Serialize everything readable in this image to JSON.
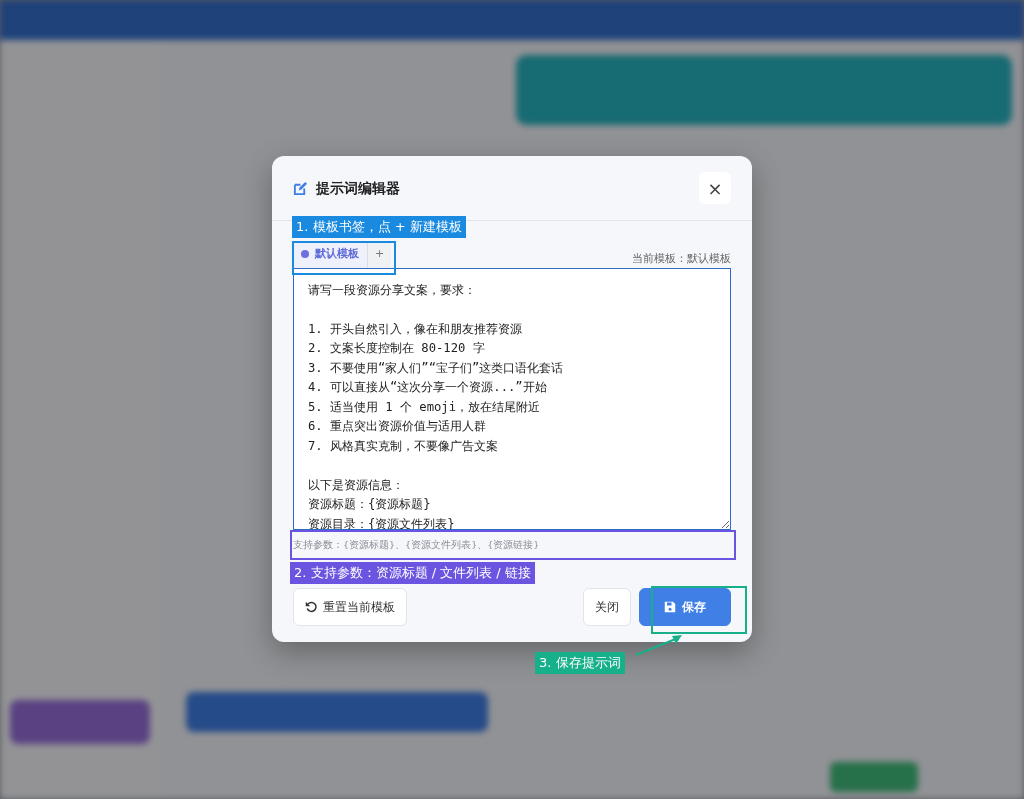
{
  "modal": {
    "title": "提示词编辑器",
    "close_icon": "×",
    "tabs": [
      {
        "label": "默认模板",
        "selected": true,
        "color": "#6f6fe0"
      }
    ],
    "add_tab": "+",
    "current_template": "当前模板：默认模板",
    "prompt_paragraphs": [
      [
        "请写一段资源分享文案，要求："
      ],
      [
        "1. 开头自然引入，像在和朋友推荐资源",
        "2. 文案长度控制在 80-120 字",
        "3. 不要使用“家人们”“宝子们”这类口语化套话",
        "4. 可以直接从“这次分享一个资源...”开始",
        "5. 适当使用 1 个 emoji，放在结尾附近",
        "6. 重点突出资源价值与适用人群",
        "7. 风格真实克制，不要像广告文案"
      ],
      [
        "以下是资源信息：",
        "资源标题：{资源标题}",
        "资源目录：{资源文件列表}"
      ]
    ],
    "hint": "支持参数：{资源标题}、{资源文件列表}、{资源链接}",
    "buttons": [
      {
        "label": "重置当前模板",
        "kind": "reset"
      },
      {
        "label": "关闭",
        "kind": "close"
      },
      {
        "label": "保存",
        "kind": "save"
      }
    ]
  },
  "annotations": [
    {
      "label": "1. 模板书签，点 + 新建模板",
      "color": "#1a8ae0"
    },
    {
      "label": "2. 支持参数：资源标题 / 文件列表 / 链接",
      "color": "#6b55e0"
    },
    {
      "label": "3. 保存提示词",
      "color": "#17b08a"
    }
  ]
}
